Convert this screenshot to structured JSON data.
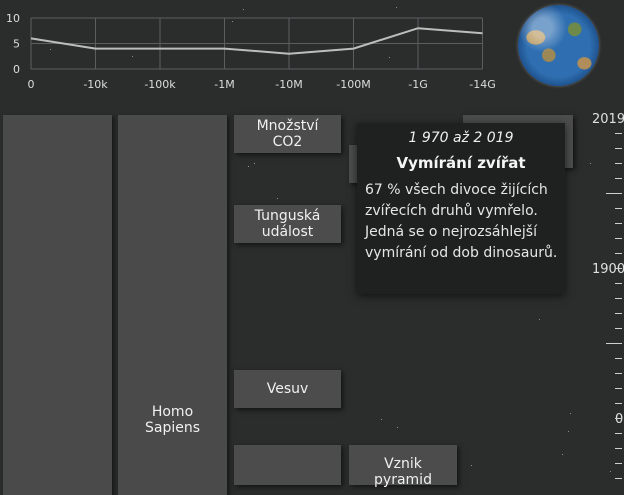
{
  "chart": {
    "y_ticks": [
      "10",
      "5",
      "0"
    ],
    "x_ticks": [
      "0",
      "-10k",
      "-100k",
      "-1M",
      "-10M",
      "-100M",
      "-1G",
      "-14G"
    ],
    "ylim": [
      0,
      10
    ],
    "values": [
      6,
      4,
      4,
      4,
      3,
      4,
      8,
      7
    ]
  },
  "timeline": {
    "columns": [
      {
        "label": ""
      },
      {
        "label": "Homo\nSapiens"
      }
    ],
    "events": {
      "co2": "Množství\nCO2",
      "tunguska": "Tunguská\nudálost",
      "vesuvius": "Vesuv",
      "pyramids": "Vznik\npyramid"
    }
  },
  "tooltip": {
    "range": "1 970 až 2 019",
    "title": "Vymírání zvířat",
    "body": "67 % všech divoce žijících zvířecích druhů vymřelo. Jedná se o nejrozsáhlejší vymírání od dob dinosaurů."
  },
  "scale": {
    "labels": [
      "2019",
      "1900",
      "0"
    ]
  }
}
